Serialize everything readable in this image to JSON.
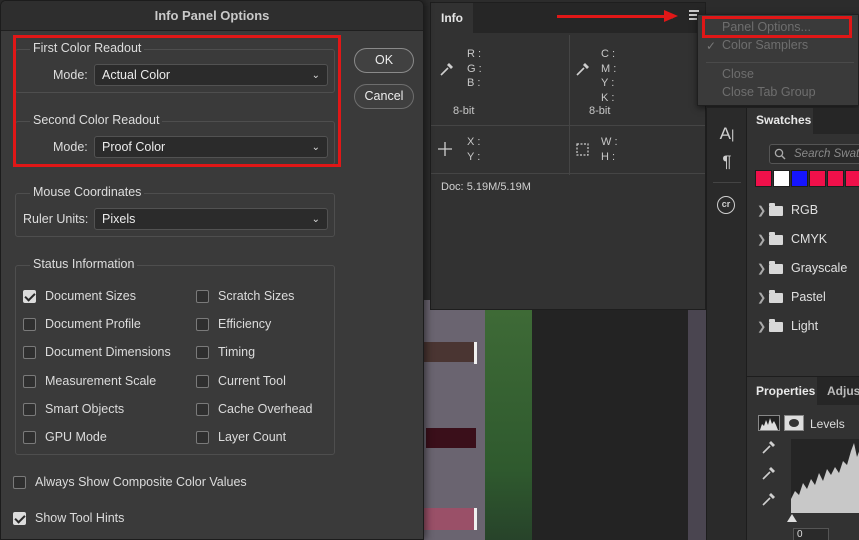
{
  "dialog": {
    "title": "Info Panel Options",
    "first_readout": {
      "label": "First Color Readout",
      "mode_label": "Mode:",
      "mode_value": "Actual Color"
    },
    "second_readout": {
      "label": "Second Color Readout",
      "mode_label": "Mode:",
      "mode_value": "Proof Color"
    },
    "mouse": {
      "label": "Mouse Coordinates",
      "units_label": "Ruler Units:",
      "units_value": "Pixels"
    },
    "status": {
      "label": "Status Information",
      "left": [
        {
          "label": "Document Sizes",
          "checked": true
        },
        {
          "label": "Document Profile",
          "checked": false
        },
        {
          "label": "Document Dimensions",
          "checked": false
        },
        {
          "label": "Measurement Scale",
          "checked": false
        },
        {
          "label": "Smart Objects",
          "checked": false
        },
        {
          "label": "GPU Mode",
          "checked": false
        }
      ],
      "right": [
        {
          "label": "Scratch Sizes",
          "checked": false
        },
        {
          "label": "Efficiency",
          "checked": false
        },
        {
          "label": "Timing",
          "checked": false
        },
        {
          "label": "Current Tool",
          "checked": false
        },
        {
          "label": "Cache Overhead",
          "checked": false
        },
        {
          "label": "Layer Count",
          "checked": false
        }
      ]
    },
    "always_composite": {
      "label": "Always Show Composite Color Values",
      "checked": false
    },
    "tool_hints": {
      "label": "Show Tool Hints",
      "checked": true
    },
    "ok_label": "OK",
    "cancel_label": "Cancel"
  },
  "info_panel": {
    "tab": "Info",
    "rgb": [
      "R :",
      "G :",
      "B :"
    ],
    "cmyk": [
      "C :",
      "M :",
      "Y :",
      "K :"
    ],
    "bit_left": "8-bit",
    "bit_right": "8-bit",
    "xy": [
      "X :",
      "Y :"
    ],
    "wh": [
      "W :",
      "H :"
    ],
    "doc_label": "Doc:",
    "doc_value": "5.19M/5.19M",
    "menu_icon": "hamburger-menu-icon"
  },
  "flyout": {
    "items": [
      "Panel Options...",
      "Color Samplers",
      "Close",
      "Close Tab Group"
    ],
    "check_mark": "✓"
  },
  "swatches": {
    "tab": "Swatches",
    "search_placeholder": "Search Swatches",
    "chips": [
      "#f0104a",
      "#ffffff",
      "#1515ff",
      "#f0104a",
      "#f0104a",
      "#f0104a",
      "#f0104a"
    ],
    "groups": [
      "RGB",
      "CMYK",
      "Grayscale",
      "Pastel",
      "Light"
    ]
  },
  "properties": {
    "tab": "Properties",
    "tab2": "Adjust",
    "adjustment": "Levels",
    "level_value": "0"
  },
  "tools": {
    "icons": [
      "character-icon",
      "paragraph-icon",
      "cc-libraries-icon"
    ]
  },
  "colors": {
    "annotation_red": "#e01717",
    "panel_bg": "#323232",
    "dialog_bg": "#3a3a3a"
  }
}
